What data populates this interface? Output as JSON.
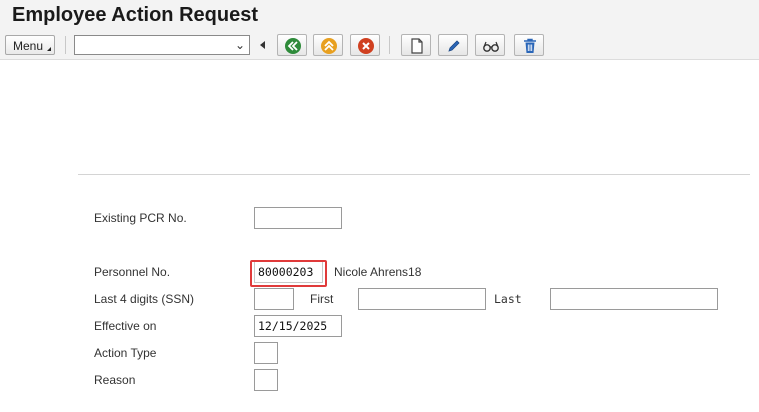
{
  "window": {
    "title": "Employee Action Request"
  },
  "toolbar": {
    "menu_label": "Menu",
    "command_field_value": "",
    "buttons": [
      {
        "name": "back-icon",
        "color": "#2e8b3a"
      },
      {
        "name": "exit-icon",
        "color": "#e8a020"
      },
      {
        "name": "cancel-icon",
        "color": "#d04020"
      },
      {
        "name": "new-document-icon",
        "color": "#444444"
      },
      {
        "name": "edit-pencil-icon",
        "color": "#2a66b8"
      },
      {
        "name": "display-glasses-icon",
        "color": "#333333"
      },
      {
        "name": "delete-trash-icon",
        "color": "#2a66b8"
      }
    ]
  },
  "form": {
    "existing_pcr": {
      "label": "Existing PCR No.",
      "value": ""
    },
    "personnel": {
      "label": "Personnel No.",
      "value": "80000203",
      "name_display": "Nicole Ahrens18"
    },
    "ssn": {
      "label": "Last 4 digits (SSN)",
      "value": "",
      "first_label": "First",
      "first_value": "",
      "last_label": "Last",
      "last_value": ""
    },
    "effective": {
      "label": "Effective on",
      "value": "12/15/2025"
    },
    "action_type": {
      "label": "Action Type",
      "value": ""
    },
    "reason": {
      "label": "Reason",
      "value": ""
    }
  },
  "colors": {
    "highlight": "#e03a3a",
    "background": "#f3f3f3"
  }
}
